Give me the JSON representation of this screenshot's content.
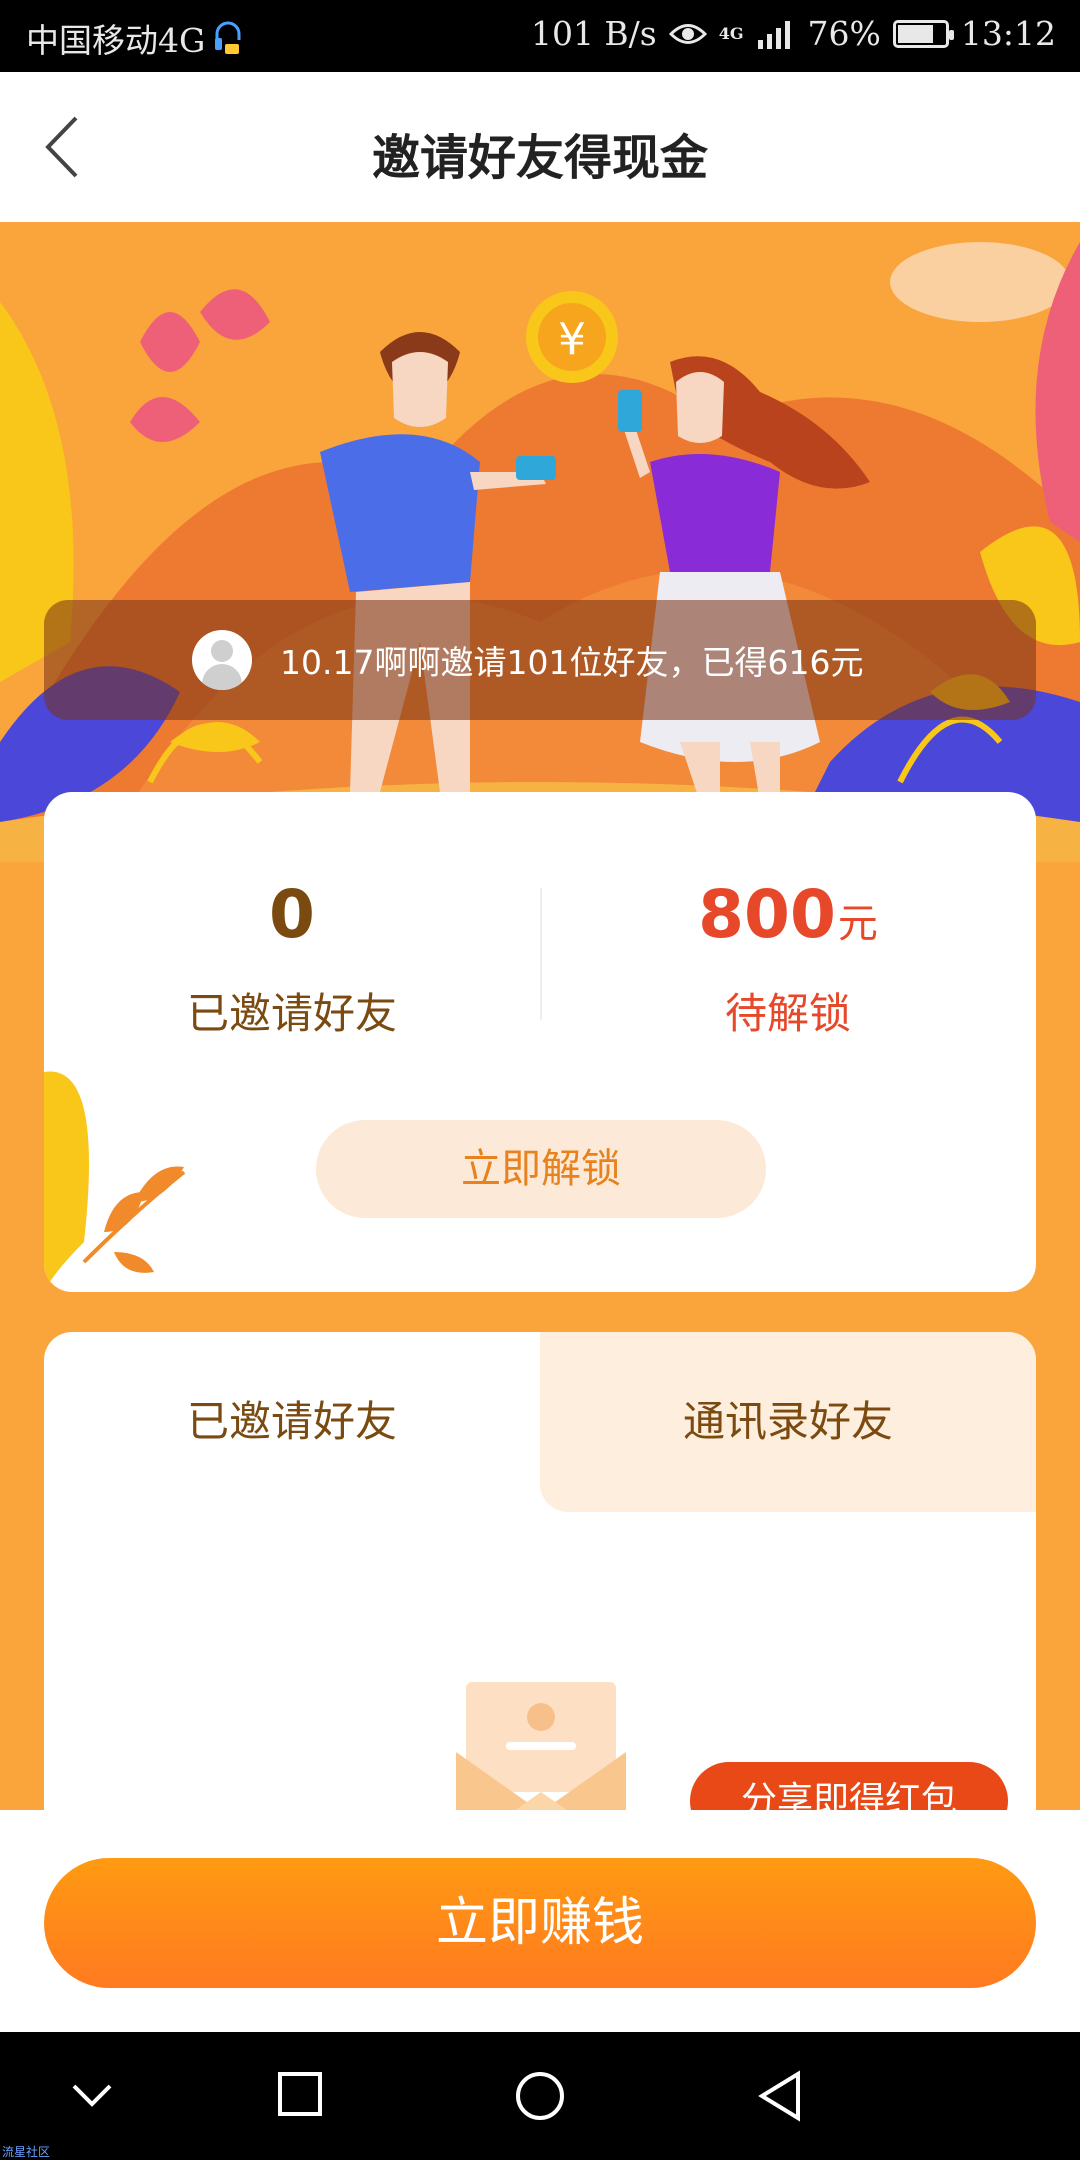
{
  "status_bar": {
    "carrier": "中国移动4G",
    "speed": "101 B/s",
    "network": "4G",
    "battery": "76%",
    "battery_level": 0.76,
    "time": "13:12"
  },
  "header": {
    "title": "邀请好友得现金"
  },
  "ticker": {
    "text": "10.17啊啊邀请101位好友，已得616元"
  },
  "stats": {
    "invited_count": "0",
    "invited_label": "已邀请好友",
    "pending_amount": "800",
    "pending_unit": "元",
    "pending_label": "待解锁",
    "unlock_button": "立即解锁"
  },
  "tabs": [
    {
      "label": "已邀请好友",
      "active": true
    },
    {
      "label": "通讯录好友",
      "active": false
    }
  ],
  "share_bubble": "分享即得红包",
  "earn_button": "立即赚钱",
  "watermark": "流星社区",
  "colors": {
    "banner_orange": "#f9a53c",
    "accent_red": "#e8482a",
    "brown_text": "#7a4a10",
    "button_orange": "#ff8c1a",
    "bubble_red": "#e94817"
  }
}
